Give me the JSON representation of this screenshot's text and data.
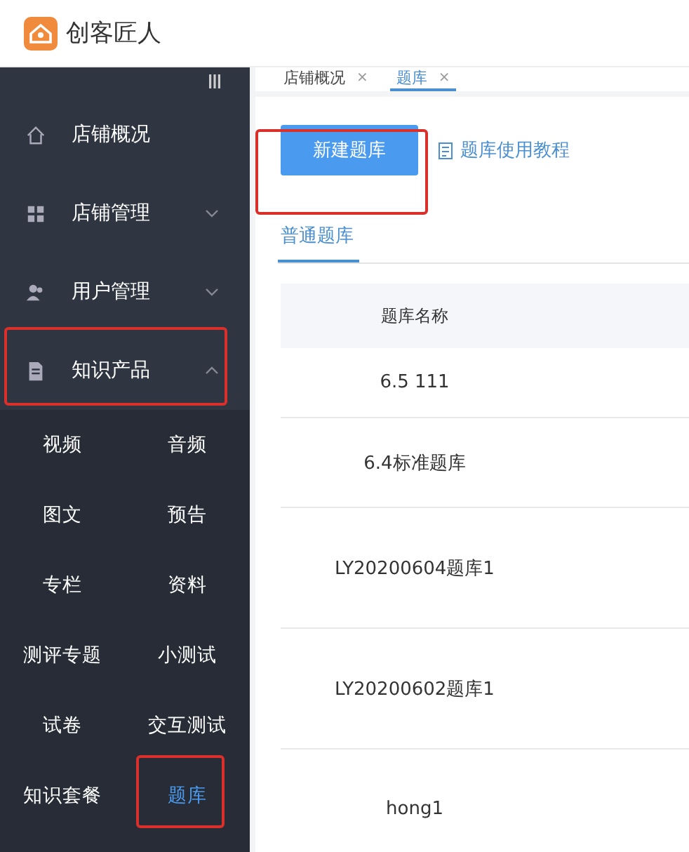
{
  "brand": {
    "name": "创客匠人"
  },
  "sidebar": {
    "items": [
      {
        "label": "店铺概况",
        "expandable": false,
        "outlined": false
      },
      {
        "label": "店铺管理",
        "expandable": true,
        "outlined": false
      },
      {
        "label": "用户管理",
        "expandable": true,
        "outlined": false
      },
      {
        "label": "知识产品",
        "expandable": true,
        "outlined": true
      }
    ],
    "subrows": [
      [
        {
          "label": "视频",
          "selected": false,
          "outlined": false
        },
        {
          "label": "音频",
          "selected": false,
          "outlined": false
        }
      ],
      [
        {
          "label": "图文",
          "selected": false,
          "outlined": false
        },
        {
          "label": "预告",
          "selected": false,
          "outlined": false
        }
      ],
      [
        {
          "label": "专栏",
          "selected": false,
          "outlined": false
        },
        {
          "label": "资料",
          "selected": false,
          "outlined": false
        }
      ],
      [
        {
          "label": "测评专题",
          "selected": false,
          "outlined": false
        },
        {
          "label": "小测试",
          "selected": false,
          "outlined": false
        }
      ],
      [
        {
          "label": "试卷",
          "selected": false,
          "outlined": false
        },
        {
          "label": "交互测试",
          "selected": false,
          "outlined": false
        }
      ],
      [
        {
          "label": "知识套餐",
          "selected": false,
          "outlined": false
        },
        {
          "label": "题库",
          "selected": true,
          "outlined": true
        }
      ]
    ]
  },
  "tabs": [
    {
      "label": "店铺概况",
      "close": "×",
      "selected": false
    },
    {
      "label": "题库",
      "close": "×",
      "selected": true
    }
  ],
  "toolbar": {
    "new_button": "新建题库",
    "new_outlined": true,
    "tutorial_link": "题库使用教程"
  },
  "subtabs": [
    {
      "label": "普通题库",
      "selected": true
    }
  ],
  "table": {
    "columns": [
      "题库名称"
    ],
    "rows": [
      "6.5 111",
      "6.4标准题库",
      "LY20200604题库1",
      "LY20200602题库1",
      "hong1"
    ]
  }
}
